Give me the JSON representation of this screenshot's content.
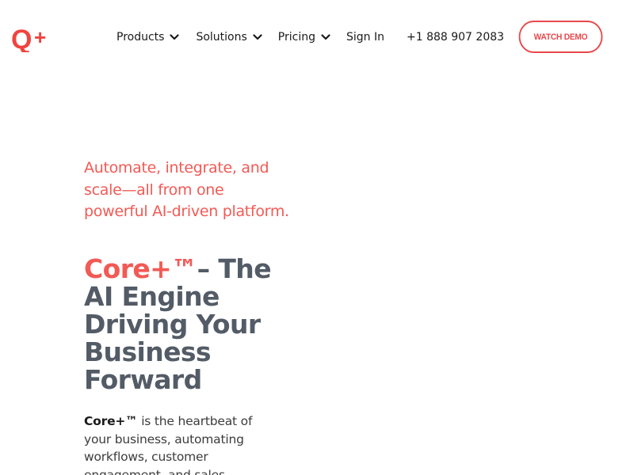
{
  "header": {
    "logo_text": "Q+",
    "nav": {
      "products": "Products",
      "solutions": "Solutions",
      "pricing": "Pricing",
      "sign_in": "Sign In",
      "phone": "+1 888 907 2083"
    },
    "cta": "WATCH DEMO"
  },
  "hero": {
    "tagline": "Automate, integrate, and scale—all from one powerful AI-driven platform.",
    "headline_brand": "Core+™",
    "headline_rest": "– The AI Engine Driving Your Business Forward",
    "body_strong": "Core+™",
    "body_rest": " is the heartbeat of your business, automating workflows, customer engagement, and sales"
  },
  "colors": {
    "accent": "#f25a55",
    "button_border": "#e8474b",
    "heading": "#535b66"
  },
  "icons": [
    "logo-icon",
    "chevron-down-icon"
  ]
}
